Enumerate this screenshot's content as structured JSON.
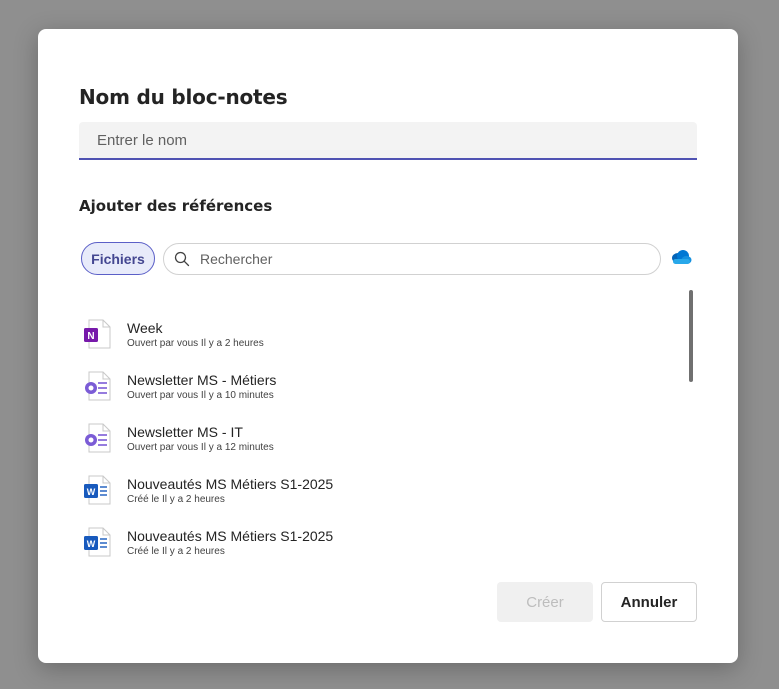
{
  "dialog": {
    "title": "Nom du bloc-notes",
    "name_placeholder": "Entrer le nom",
    "references_title": "Ajouter des références",
    "filter_chip": "Fichiers",
    "search_placeholder": "Rechercher",
    "cloud_icon": "onedrive-cloud-icon",
    "accent_color": "#5b5fc7",
    "files": [
      {
        "name": "Week",
        "meta": "Ouvert par vous Il y a 2 heures",
        "icon": "onenote-file-icon"
      },
      {
        "name": "Newsletter MS - Métiers",
        "meta": "Ouvert par vous Il y a 10 minutes",
        "icon": "loop-file-icon"
      },
      {
        "name": "Newsletter MS - IT",
        "meta": "Ouvert par vous Il y a 12 minutes",
        "icon": "loop-file-icon"
      },
      {
        "name": "Nouveautés MS Métiers S1-2025",
        "meta": "Créé le Il y a 2 heures",
        "icon": "word-file-icon"
      },
      {
        "name": "Nouveautés MS Métiers S1-2025",
        "meta": "Créé le Il y a 2 heures",
        "icon": "word-file-icon"
      }
    ],
    "create_label": "Créer",
    "cancel_label": "Annuler"
  }
}
